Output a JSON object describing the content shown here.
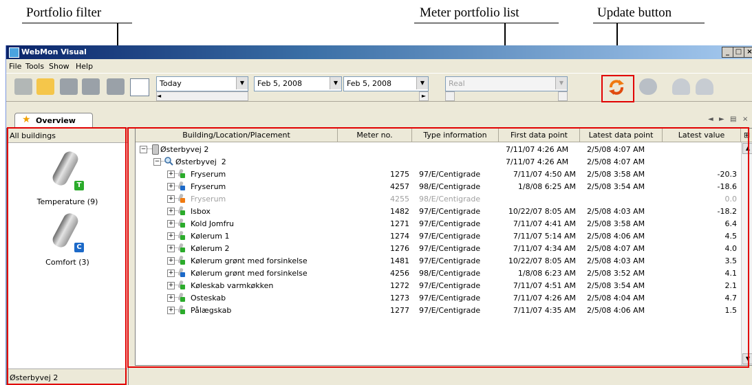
{
  "annotations": {
    "portfolio_filter": "Portfolio filter",
    "meter_portfolio_list": "Meter portfolio list",
    "update_button": "Update button"
  },
  "window": {
    "title": "WebMon Visual",
    "controls": [
      "_",
      "□",
      "×"
    ]
  },
  "menu": [
    "File",
    "Tools",
    "Show",
    "Help"
  ],
  "toolbar": {
    "period_combo": "Today",
    "from_date": "Feb 5, 2008",
    "to_date": "Feb 5, 2008",
    "value_type_combo": "Real"
  },
  "tab": {
    "label": "Overview",
    "icon": "star-icon"
  },
  "portfolio_filter": {
    "header": "All buildings",
    "categories": [
      {
        "label": "Temperature (9)",
        "badge": "T",
        "badge_color": "#2bab2b"
      },
      {
        "label": "Comfort (3)",
        "badge": "C",
        "badge_color": "#1c69c8"
      }
    ],
    "footer": "Østerbyvej 2"
  },
  "grid": {
    "columns": [
      "Building/Location/Placement",
      "Meter no.",
      "Type information",
      "First data point",
      "Latest data point",
      "Latest value"
    ],
    "top_rows": [
      {
        "name": "Østerbyvej 2",
        "first": "7/11/07 4:26 AM",
        "latest": "2/5/08 4:07 AM"
      },
      {
        "name": "Østerbyvej  2",
        "first": "7/11/07 4:26 AM",
        "latest": "2/5/08 4:07 AM"
      }
    ],
    "rows": [
      {
        "name": "Fryserum",
        "meter": "1275",
        "type": "97/E/Centigrade",
        "first": "7/11/07 4:50 AM",
        "latest": "2/5/08 3:58 AM",
        "value": "-20.3",
        "icon": "green",
        "disabled": false
      },
      {
        "name": "Fryserum",
        "meter": "4257",
        "type": "98/E/Centigrade",
        "first": "1/8/08 6:25 AM",
        "latest": "2/5/08 3:54 AM",
        "value": "-18.6",
        "icon": "blue",
        "disabled": false
      },
      {
        "name": "Fryserum",
        "meter": "4255",
        "type": "98/E/Centigrade",
        "first": "",
        "latest": "",
        "value": "0.0",
        "icon": "orange",
        "disabled": true
      },
      {
        "name": "Isbox",
        "meter": "1482",
        "type": "97/E/Centigrade",
        "first": "10/22/07 8:05 AM",
        "latest": "2/5/08 4:03 AM",
        "value": "-18.2",
        "icon": "green",
        "disabled": false
      },
      {
        "name": "Kold Jomfru",
        "meter": "1271",
        "type": "97/E/Centigrade",
        "first": "7/11/07 4:41 AM",
        "latest": "2/5/08 3:58 AM",
        "value": "6.4",
        "icon": "green",
        "disabled": false
      },
      {
        "name": "Kølerum 1",
        "meter": "1274",
        "type": "97/E/Centigrade",
        "first": "7/11/07 5:14 AM",
        "latest": "2/5/08 4:06 AM",
        "value": "4.5",
        "icon": "green",
        "disabled": false
      },
      {
        "name": "Kølerum 2",
        "meter": "1276",
        "type": "97/E/Centigrade",
        "first": "7/11/07 4:34 AM",
        "latest": "2/5/08 4:07 AM",
        "value": "4.0",
        "icon": "green",
        "disabled": false
      },
      {
        "name": "Kølerum grønt med forsinkelse",
        "meter": "1481",
        "type": "97/E/Centigrade",
        "first": "10/22/07 8:05 AM",
        "latest": "2/5/08 4:03 AM",
        "value": "3.5",
        "icon": "green",
        "disabled": false
      },
      {
        "name": "Kølerum grønt med forsinkelse",
        "meter": "4256",
        "type": "98/E/Centigrade",
        "first": "1/8/08 6:23 AM",
        "latest": "2/5/08 3:52 AM",
        "value": "4.1",
        "icon": "blue",
        "disabled": false
      },
      {
        "name": "Køleskab varmkøkken",
        "meter": "1272",
        "type": "97/E/Centigrade",
        "first": "7/11/07 4:51 AM",
        "latest": "2/5/08 3:54 AM",
        "value": "2.1",
        "icon": "green",
        "disabled": false
      },
      {
        "name": "Osteskab",
        "meter": "1273",
        "type": "97/E/Centigrade",
        "first": "7/11/07 4:26 AM",
        "latest": "2/5/08 4:04 AM",
        "value": "4.7",
        "icon": "green",
        "disabled": false
      },
      {
        "name": "Pålægskab",
        "meter": "1277",
        "type": "97/E/Centigrade",
        "first": "7/11/07 4:35 AM",
        "latest": "2/5/08 4:06 AM",
        "value": "1.5",
        "icon": "green",
        "disabled": false
      }
    ]
  }
}
